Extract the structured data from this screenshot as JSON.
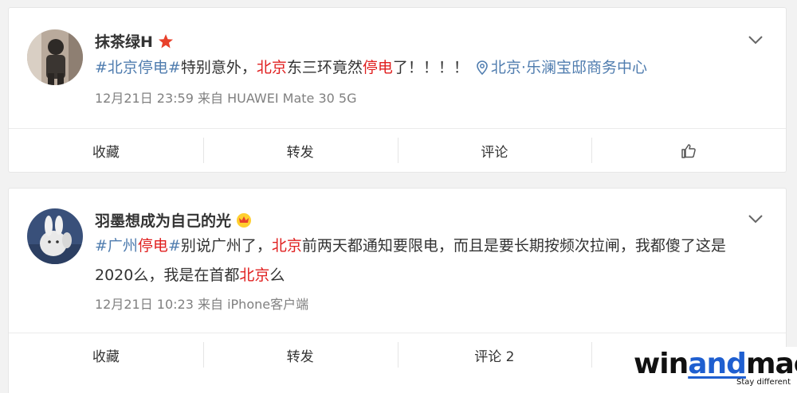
{
  "posts": [
    {
      "username": "抹茶绿H",
      "badge": "star-badge-icon",
      "content": {
        "topic": "#北京停电#",
        "t1": "特别意外，",
        "k1": "北京",
        "t2": "东三环竟然",
        "k2": "停电",
        "t3": "了！！！！",
        "location": "北京·乐澜宝邸商务中心"
      },
      "meta": "12月21日 23:59  来自 HUAWEI Mate 30 5G",
      "actions": {
        "favorite": "收藏",
        "repost": "转发",
        "comment": "评论"
      }
    },
    {
      "username": "羽墨想成为自己的光",
      "badge": "crown-badge-icon",
      "content": {
        "topic_a": "#广州",
        "topic_k": "停电",
        "topic_b": "#",
        "t1": "别说广州了，",
        "k1": "北京",
        "t2": "前两天都通知要限电，而且是要长期按频次拉闸，我都傻了这是2020么，我是在首都",
        "k2": "北京",
        "t3": "么"
      },
      "meta": "12月21日 10:23  来自 iPhone客户端",
      "actions": {
        "favorite": "收藏",
        "repost": "转发",
        "comment": "评论 2"
      }
    }
  ],
  "watermark": {
    "win": "win",
    "and": "and",
    "mac": "mac",
    "tagline": "Stay different"
  },
  "colors": {
    "topic": "#507daf",
    "keyword": "#e02020",
    "meta": "#808080"
  }
}
